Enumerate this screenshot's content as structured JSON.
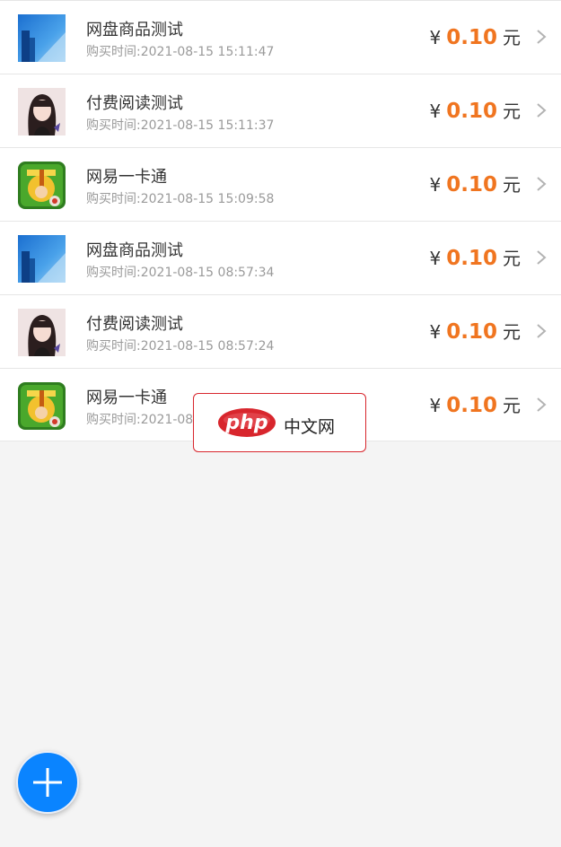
{
  "orders": [
    {
      "title": "网盘商品测试",
      "time_label": "购买时间:",
      "time": "2021-08-15 15:11:47",
      "currency": "¥",
      "amount": "0.10",
      "unit": "元",
      "thumb_icon": "city-photo-icon"
    },
    {
      "title": "付费阅读测试",
      "time_label": "购买时间:",
      "time": "2021-08-15 15:11:37",
      "currency": "¥",
      "amount": "0.10",
      "unit": "元",
      "thumb_icon": "girl-portrait-icon"
    },
    {
      "title": "网易一卡通",
      "time_label": "购买时间:",
      "time": "2021-08-15 15:09:58",
      "currency": "¥",
      "amount": "0.10",
      "unit": "元",
      "thumb_icon": "netease-game-icon"
    },
    {
      "title": "网盘商品测试",
      "time_label": "购买时间:",
      "time": "2021-08-15 08:57:34",
      "currency": "¥",
      "amount": "0.10",
      "unit": "元",
      "thumb_icon": "city-photo-icon"
    },
    {
      "title": "付费阅读测试",
      "time_label": "购买时间:",
      "time": "2021-08-15 08:57:24",
      "currency": "¥",
      "amount": "0.10",
      "unit": "元",
      "thumb_icon": "girl-portrait-icon"
    },
    {
      "title": "网易一卡通",
      "time_label": "购买时间:",
      "time": "2021-08",
      "currency": "¥",
      "amount": "0.10",
      "unit": "元",
      "thumb_icon": "netease-game-icon"
    }
  ],
  "watermark": {
    "logo_text": "php",
    "text": "中文网"
  },
  "fab": {
    "icon": "plus-icon"
  },
  "colors": {
    "price": "#f07520",
    "fab": "#0a84ff",
    "watermark_border": "#d8262d"
  }
}
